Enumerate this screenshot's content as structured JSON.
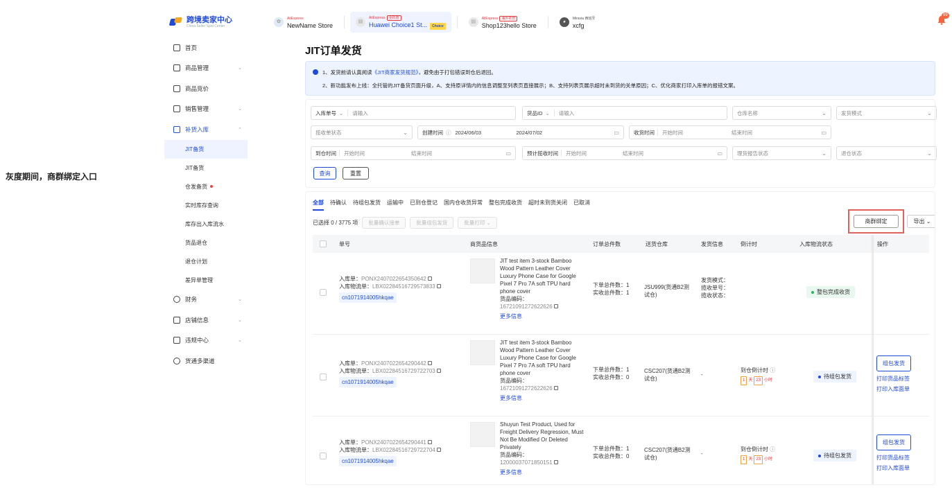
{
  "annotation": "灰度期间，商群绑定入口",
  "header": {
    "logo_title": "跨境卖家中心",
    "logo_subtitle": "China Seller Spot Center",
    "stores": [
      {
        "brand": "AliExpress",
        "tag": "",
        "name": "NewName Store",
        "extra": ""
      },
      {
        "brand": "AliExpress",
        "tag": "全托管",
        "name": "Huawei Choice1 St...",
        "extra": "Choice"
      },
      {
        "brand": "AliExpress",
        "tag": "海外托管",
        "name": "Shop123hello Store",
        "extra": ""
      },
      {
        "brand": "Miravia 西班牙",
        "tag": "",
        "name": "xcfg",
        "extra": ""
      }
    ],
    "notification_count": "99"
  },
  "sidebar": {
    "items": [
      {
        "label": "首页",
        "chevron": ""
      },
      {
        "label": "商品管理",
        "chevron": "⌄"
      },
      {
        "label": "商品竞价",
        "chevron": ""
      },
      {
        "label": "销售管理",
        "chevron": "⌄"
      },
      {
        "label": "补货入库",
        "chevron": "⌃"
      }
    ],
    "sub_items": [
      "JIT备货",
      "JIT备货",
      "仓发备货",
      "实时库存查询",
      "库存出入库流水",
      "货品退仓",
      "退仓计划",
      "差异单管理"
    ],
    "items_bottom": [
      {
        "label": "财务",
        "chevron": "⌄"
      },
      {
        "label": "店铺信息",
        "chevron": "⌄"
      },
      {
        "label": "违规中心",
        "chevron": "⌄"
      },
      {
        "label": "货通多渠道",
        "chevron": ""
      }
    ]
  },
  "main": {
    "title": "JIT订单发货",
    "notice": {
      "line1_prefix": "1、发货前请认真阅读",
      "line1_link": "《JIT商家发货规范》",
      "line1_suffix": "，避免由于打包错误到仓后退回。",
      "line2": "2、新功能发布上线：全托管的JIT备货页面升级，A、支持原详情内的信息调整至列表页直接展示；B、支持列表页展示超时未到货的关单原因；C、优化商家打印入库单的报错文案。"
    },
    "filters": {
      "order_no_label": "入库单号",
      "order_no_placeholder": "请输入",
      "goods_id_label": "货品ID",
      "goods_id_placeholder": "请输入",
      "warehouse": "仓库名称",
      "ship_mode": "发货模式",
      "pickup_status": "揽收单状态",
      "create_time_label": "创建时间",
      "create_start": "2024/06/03",
      "create_end": "2024/07/02",
      "receive_time_label": "收货时间",
      "receive_start": "开始时间",
      "receive_end": "结束时间",
      "arrive_time_label": "到仓时间",
      "arrive_start": "开始时间",
      "arrive_end": "结束时间",
      "pickup_time_label": "预计揽收时间",
      "pickup_start": "开始时间",
      "pickup_end": "结束时间",
      "report_status": "理货报告状态",
      "return_status": "退仓状态",
      "query": "查询",
      "reset": "重置"
    },
    "tabs": [
      "全部",
      "待确认",
      "待组包发货",
      "运输中",
      "已到仓登记",
      "国内仓收货异常",
      "整包完成收货",
      "超时未到货关闭",
      "已取消"
    ],
    "toolbar": {
      "selected": "已选择 0 / 3775 项",
      "batch_confirm": "批量确认接单",
      "batch_pack": "批量组包发货",
      "batch_print": "批量打印",
      "bind": "商群绑定",
      "export": "导出"
    },
    "table": {
      "headers": [
        "单号",
        "商货品信息",
        "订单总件数",
        "送货仓库",
        "发货信息",
        "倒计时",
        "入库物流状态",
        "操作"
      ],
      "rows": [
        {
          "inbound_label": "入库单：",
          "inbound_no": "PONX2407022654350642",
          "logistics_label": "入库物流单：",
          "logistics_no": "LBX02284516729573833",
          "tag": "cn1071914005hkqae",
          "product": "JIT test item 3-stock Bamboo Wood Pattern Leather Cover Luxury Phone Case for Google Pixel 7 Pro 7A soft TPU hard phone cover",
          "code_label": "货品编码：",
          "code": "16721091272622626",
          "more": "更多信息",
          "qty_order": "下单总件数：1",
          "qty_received": "实收总件数：1",
          "warehouse": "JSU999(货通B2测试仓)",
          "ship_info": [
            "发货模式：",
            "揽收单号：",
            "揽收状态："
          ],
          "countdown_label": "",
          "countdown_days": "",
          "countdown_hours": "",
          "status": "整包完成收货",
          "ops": []
        },
        {
          "inbound_label": "入库单：",
          "inbound_no": "PONX2407022654290442",
          "logistics_label": "入库物流单：",
          "logistics_no": "LBX02284516729722703",
          "tag": "cn1071914005hkqae",
          "product": "JIT test item 3-stock Bamboo Wood Pattern Leather Cover Luxury Phone Case for Google Pixel 7 Pro 7A soft TPU hard phone cover",
          "code_label": "货品编码：",
          "code": "16721091272622626",
          "more": "更多信息",
          "qty_order": "下单总件数：1",
          "qty_received": "实收总件数：0",
          "warehouse": "CSC207(货通B2测试仓)",
          "ship_info": [
            "-"
          ],
          "countdown_label": "到仓倒计时",
          "countdown_days": "1",
          "countdown_hours": "23",
          "status": "待组包发货",
          "ops": [
            "组包发货",
            "打印货品标签",
            "打印入库面单"
          ]
        },
        {
          "inbound_label": "入库单：",
          "inbound_no": "PONX2407022654290441",
          "logistics_label": "入库物流单：",
          "logistics_no": "LBX02284516729722704",
          "tag": "cn1071914005hkqae",
          "product": "Shuyun Test Product, Used for Freight Delivery Regression, Must Not Be Modified Or Deleted Privately",
          "code_label": "货品编码：",
          "code": "12000037071850151",
          "more": "更多信息",
          "qty_order": "下单总件数：1",
          "qty_received": "实收总件数：0",
          "warehouse": "CSC207(货通B2测试仓)",
          "ship_info": [
            "-"
          ],
          "countdown_label": "到仓倒计时",
          "countdown_days": "1",
          "countdown_hours": "23",
          "status": "待组包发货",
          "ops": [
            "组包发货",
            "打印货品标签",
            "打印入库面单"
          ]
        }
      ],
      "day_unit": "天",
      "hour_unit": "小时"
    }
  }
}
